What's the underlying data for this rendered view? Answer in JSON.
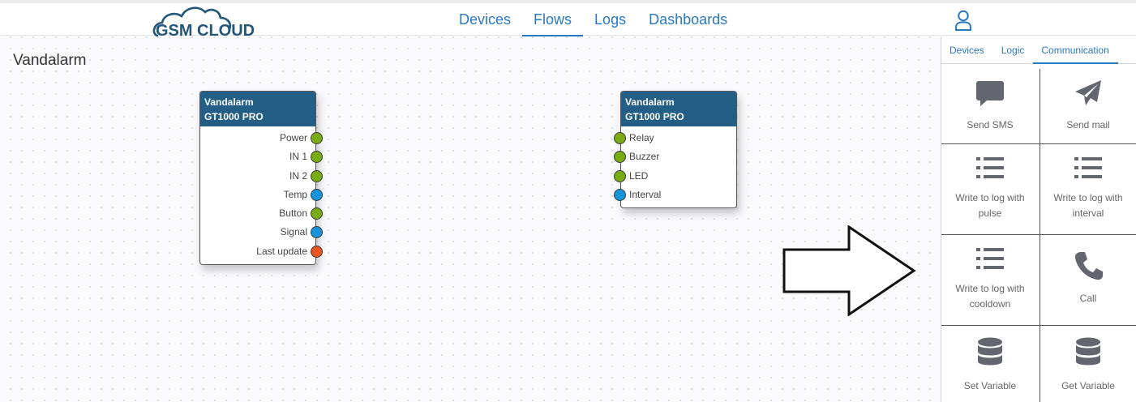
{
  "brand": {
    "logo_text_gsm": "GSM",
    "logo_text_cloud": "CLOUD",
    "color": "#23577a"
  },
  "nav": {
    "items": [
      {
        "label": "Devices",
        "active": false
      },
      {
        "label": "Flows",
        "active": true
      },
      {
        "label": "Logs",
        "active": false
      },
      {
        "label": "Dashboards",
        "active": false
      }
    ],
    "user_icon": "user-icon"
  },
  "canvas": {
    "title": "Vandalarm",
    "nodes": [
      {
        "name": "Vandalarm",
        "model": "GT1000 PRO",
        "ports": [
          {
            "label": "Power",
            "color": "green"
          },
          {
            "label": "IN 1",
            "color": "green"
          },
          {
            "label": "IN 2",
            "color": "green"
          },
          {
            "label": "Temp",
            "color": "blue"
          },
          {
            "label": "Button",
            "color": "green"
          },
          {
            "label": "Signal",
            "color": "blue"
          },
          {
            "label": "Last update",
            "color": "red"
          }
        ]
      },
      {
        "name": "Vandalarm",
        "model": "GT1000 PRO",
        "ports": [
          {
            "label": "Relay",
            "color": "green"
          },
          {
            "label": "Buzzer",
            "color": "green"
          },
          {
            "label": "LED",
            "color": "green"
          },
          {
            "label": "Interval",
            "color": "blue"
          }
        ]
      }
    ],
    "arrow_icon": "right-arrow-icon"
  },
  "sidebar": {
    "tabs": [
      {
        "label": "Devices",
        "active": false
      },
      {
        "label": "Logic",
        "active": false
      },
      {
        "label": "Communication",
        "active": true
      }
    ],
    "items": [
      {
        "label": "Send SMS",
        "icon": "message-icon"
      },
      {
        "label": "Send mail",
        "icon": "paper-plane-icon"
      },
      {
        "label": "Write to log with pulse",
        "icon": "list-icon"
      },
      {
        "label": "Write to log with interval",
        "icon": "list-icon"
      },
      {
        "label": "Write to log with cooldown",
        "icon": "list-icon"
      },
      {
        "label": "Call",
        "icon": "phone-icon"
      },
      {
        "label": "Set Variable",
        "icon": "database-icon"
      },
      {
        "label": "Get Variable",
        "icon": "database-icon"
      }
    ]
  },
  "colors": {
    "accent": "#2a79c0",
    "node_header": "#235e86",
    "port_green": "#79ab14",
    "port_blue": "#1594dc",
    "port_red": "#ea5420",
    "icon_gray": "#63666e"
  }
}
